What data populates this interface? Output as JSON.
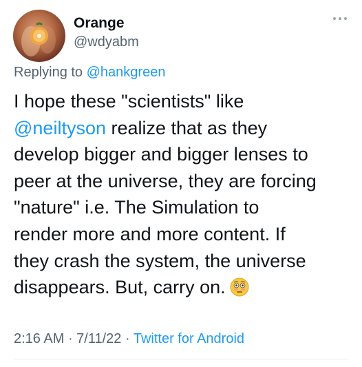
{
  "author": {
    "display_name": "Orange",
    "handle": "@wdyabm"
  },
  "reply": {
    "prefix": "Replying to ",
    "target": "@hankgreen"
  },
  "tweet": {
    "line1": "I hope these \"scientists\" like",
    "mention": "@neiltyson",
    "line2_rest": " realize that as they",
    "line3": "develop bigger and bigger lenses to",
    "line4": "peer at the universe, they are forcing",
    "line5": "\"nature\" i.e. The Simulation to",
    "line6": "render more and more content. If",
    "line7": "they crash the system, the universe",
    "line8": "disappears. But, carry on.",
    "emoji": "flushed-face-emoji"
  },
  "meta": {
    "time": "2:16 AM",
    "sep1": " · ",
    "date": "7/11/22",
    "sep2": " · ",
    "source": "Twitter for Android"
  },
  "colors": {
    "link": "#1d9bf0",
    "text": "#0f1419",
    "secondary": "#536471"
  },
  "icons": {
    "more": "more-dots-icon",
    "avatar": "orange-avatar"
  }
}
